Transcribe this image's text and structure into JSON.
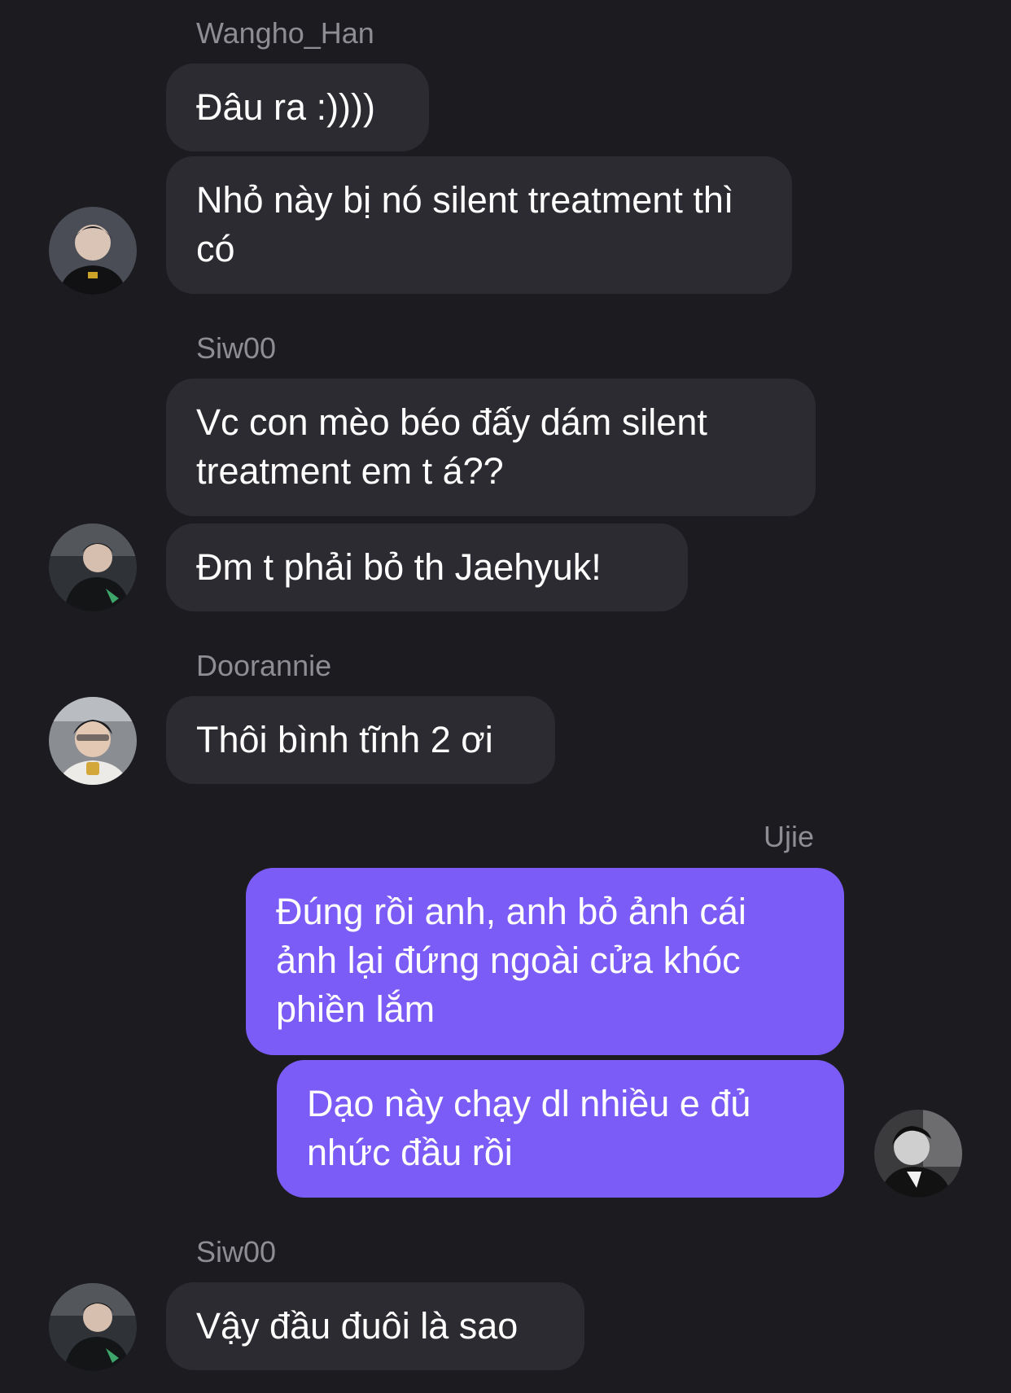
{
  "messages": [
    {
      "sender": "Wangho_Han",
      "text": "Đâu ra :))))"
    },
    {
      "text": "Nhỏ này bị nó silent treatment thì có"
    },
    {
      "sender": "Siw00",
      "text": "Vc con mèo béo đấy dám silent treatment em t á??"
    },
    {
      "text": "Đm t phải bỏ th Jaehyuk!"
    },
    {
      "sender": "Doorannie",
      "text": "Thôi bình tĩnh 2 ơi"
    },
    {
      "sender": "Ujie",
      "text": "Đúng rồi anh, anh bỏ ảnh cái ảnh lại đứng ngoài cửa khóc phiền lắm"
    },
    {
      "text": "Dạo này chạy dl nhiều e đủ nhức đầu rồi"
    },
    {
      "sender": "Siw00",
      "text": "Vậy đầu đuôi là sao"
    }
  ],
  "colors": {
    "background": "#1c1b20",
    "incoming_bubble": "#2c2b31",
    "outgoing_bubble": "#7c5cf7",
    "sender_name": "#8e8d93"
  }
}
